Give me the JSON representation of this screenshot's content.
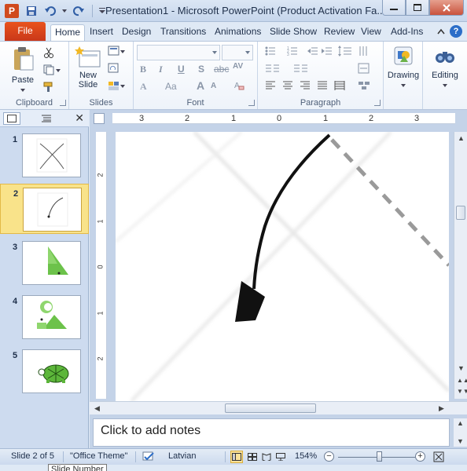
{
  "window": {
    "title": "Presentation1  -  Microsoft PowerPoint (Product Activation Fa...",
    "app_icon_letter": "P"
  },
  "tabs": {
    "file": "File",
    "items": [
      "Home",
      "Insert",
      "Design",
      "Transitions",
      "Animations",
      "Slide Show",
      "Review",
      "View",
      "Add-Ins"
    ],
    "active": "Home",
    "help": "?"
  },
  "ribbon": {
    "clipboard": {
      "label": "Clipboard",
      "paste": "Paste"
    },
    "slides": {
      "label": "Slides",
      "new_slide_1": "New",
      "new_slide_2": "Slide"
    },
    "font": {
      "label": "Font",
      "bold": "B",
      "italic": "I",
      "underline": "U",
      "strike": "S",
      "strike2": "abc",
      "spacing": "AV",
      "aa": "Aa",
      "grow": "A",
      "shrink": "A"
    },
    "paragraph": {
      "label": "Paragraph"
    },
    "drawing": {
      "label": "Drawing"
    },
    "editing": {
      "label": "Editing"
    }
  },
  "slides_panel": {
    "slides": [
      {
        "number": "1"
      },
      {
        "number": "2",
        "selected": true
      },
      {
        "number": "3"
      },
      {
        "number": "4"
      },
      {
        "number": "5"
      }
    ]
  },
  "ruler": {
    "horizontal_ticks": [
      "3",
      "2",
      "1",
      "0",
      "1",
      "2",
      "3"
    ],
    "vertical_ticks": [
      "2",
      "1",
      "0",
      "1",
      "2"
    ]
  },
  "notes": {
    "placeholder": "Click to add notes"
  },
  "status_bar": {
    "slide_info": "Slide 2 of 5",
    "theme": "\"Office Theme\"",
    "language": "Latvian",
    "zoom": "154%",
    "zoom_fraction": 0.54
  },
  "tooltip": {
    "text": "Slide Number"
  },
  "colors": {
    "file_tab": "#d2401b",
    "selected_thumb": "#f9e38a",
    "accent_green": "#6cc24a"
  }
}
